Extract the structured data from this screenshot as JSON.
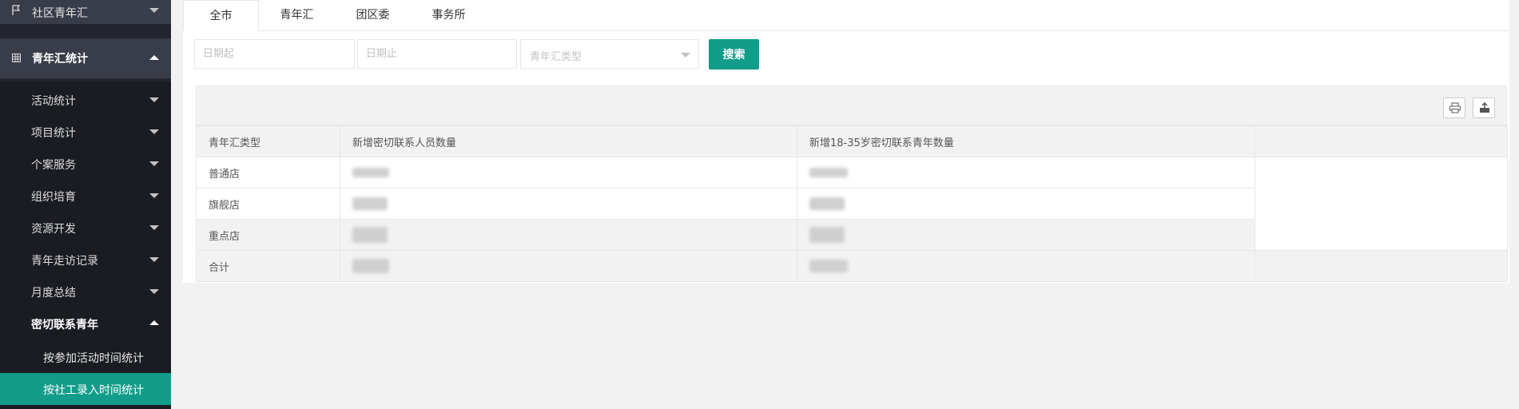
{
  "sidebar": {
    "top_item": "社区青年汇",
    "parent": "青年汇统计",
    "items": [
      {
        "label": "活动统计"
      },
      {
        "label": "项目统计"
      },
      {
        "label": "个案服务"
      },
      {
        "label": "组织培育"
      },
      {
        "label": "资源开发"
      },
      {
        "label": "青年走访记录"
      },
      {
        "label": "月度总结"
      },
      {
        "label": "密切联系青年"
      }
    ],
    "subitems": [
      {
        "label": "按参加活动时间统计"
      },
      {
        "label": "按社工录入时间统计"
      }
    ]
  },
  "tabs": [
    {
      "label": "全市"
    },
    {
      "label": "青年汇"
    },
    {
      "label": "团区委"
    },
    {
      "label": "事务所"
    }
  ],
  "filters": {
    "date_start_placeholder": "日期起",
    "date_end_placeholder": "日期止",
    "type_placeholder": "青年汇类型",
    "search_label": "搜索"
  },
  "table": {
    "headers": [
      "青年汇类型",
      "新增密切联系人员数量",
      "新增18-35岁密切联系青年数量"
    ],
    "rows": [
      {
        "type": "普通店"
      },
      {
        "type": "旗舰店"
      },
      {
        "type": "重点店"
      },
      {
        "type": "合计"
      }
    ]
  },
  "icons": [
    "flag-icon",
    "grid-icon",
    "print-icon",
    "export-icon"
  ],
  "colors": {
    "accent": "#129d8a",
    "sidebar_bg": "#23262e"
  }
}
